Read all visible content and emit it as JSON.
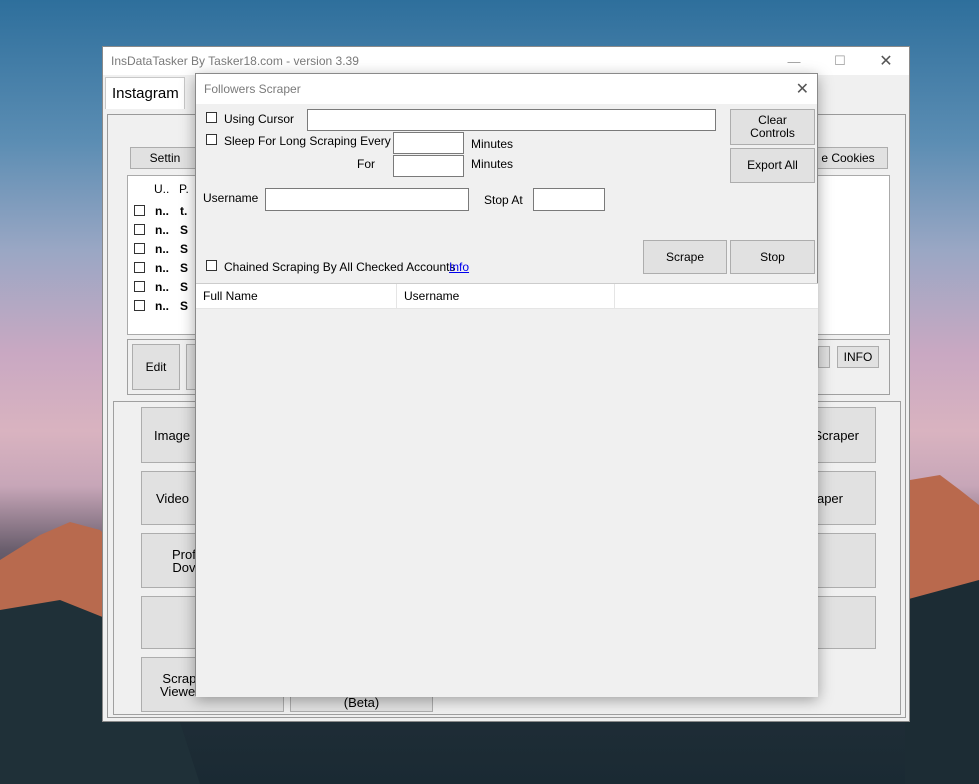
{
  "main_window": {
    "title": "InsDataTasker By Tasker18.com - version 3.39",
    "tab": "Instagram",
    "settings_button": "Settin",
    "cookies_button": "e Cookies",
    "grid_headers": [
      "U..",
      "P."
    ],
    "grid_rows": [
      {
        "c1": "n..",
        "c2": "t."
      },
      {
        "c1": "n..",
        "c2": "S"
      },
      {
        "c1": "n..",
        "c2": "S"
      },
      {
        "c1": "n..",
        "c2": "S"
      },
      {
        "c1": "n..",
        "c2": "S"
      },
      {
        "c1": "n..",
        "c2": "S"
      }
    ],
    "edit_button": "Edit",
    "info_button": "INFO",
    "left_buttons": [
      "Image",
      "Video",
      "Prof\nDov",
      "",
      "Scrape\nViewers"
    ],
    "right_buttons": [
      "Scraper",
      "aper",
      "",
      ""
    ],
    "bottom_partial": "(Beta)"
  },
  "dialog": {
    "title": "Followers Scraper",
    "using_cursor_label": "Using Cursor",
    "using_cursor_value": "",
    "sleep_label": "Sleep For Long Scraping Every",
    "sleep_every_value": "",
    "minutes_label_1": "Minutes",
    "for_label": "For",
    "sleep_for_value": "",
    "minutes_label_2": "Minutes",
    "username_label": "Username",
    "username_value": "",
    "stop_at_label": "Stop At",
    "stop_at_value": "",
    "clear_controls_button": "Clear\nControls",
    "export_all_button": "Export All",
    "scrape_button": "Scrape",
    "stop_button": "Stop",
    "chained_label": "Chained Scraping By All Checked Accounts",
    "info_link": "Info",
    "columns": [
      "Full Name",
      "Username",
      ""
    ]
  }
}
